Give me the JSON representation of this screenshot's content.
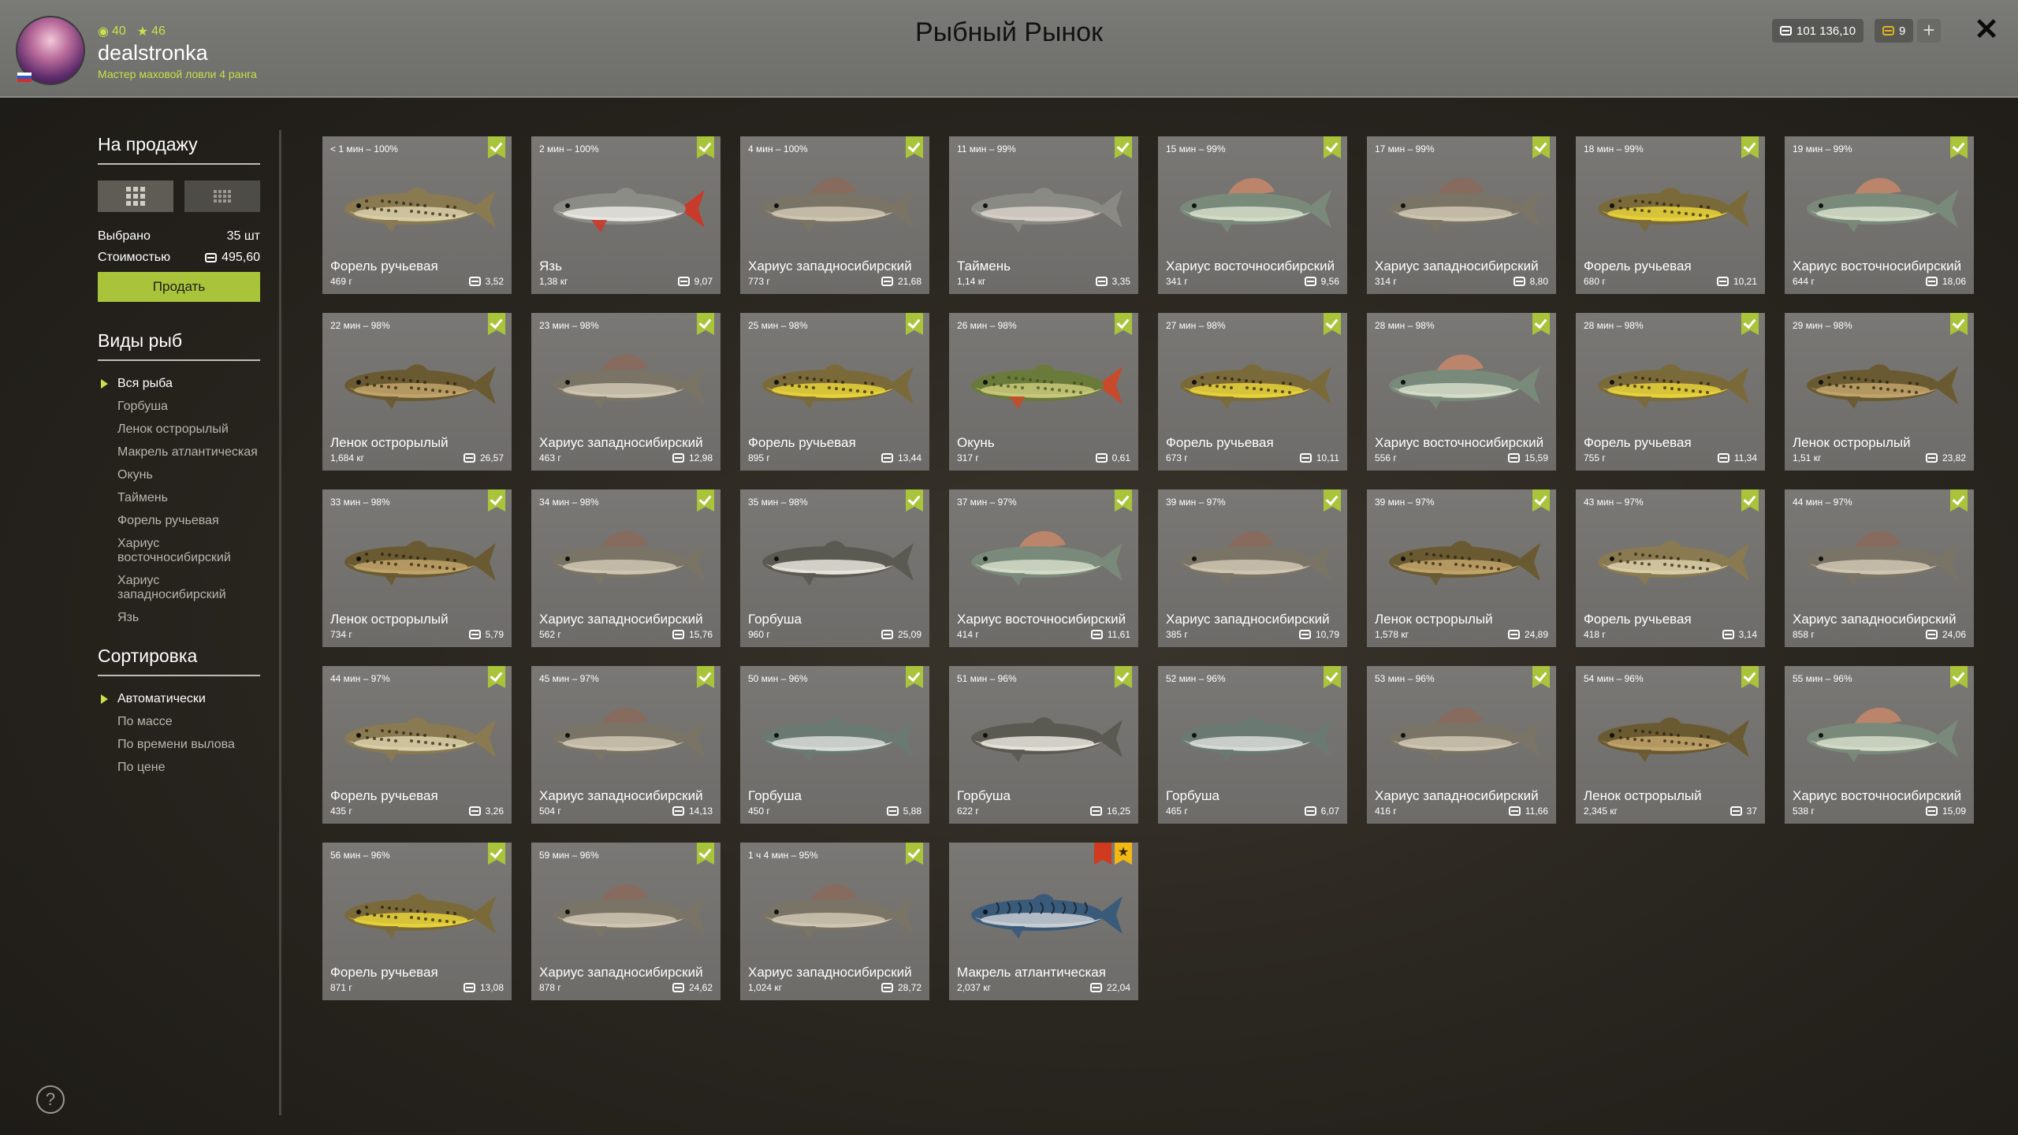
{
  "header": {
    "stat_points": "40",
    "stat_stars": "46",
    "username": "dealstronka",
    "rank": "Мастер маховой ловли 4 ранга",
    "title": "Рыбный Рынок",
    "silver": "101 136,10",
    "gold": "9"
  },
  "sidebar": {
    "sale_title": "На продажу",
    "selected_label": "Выбрано",
    "selected_value": "35 шт",
    "cost_label": "Стоимостью",
    "cost_value": "495,60",
    "sell_button": "Продать",
    "species_title": "Виды рыб",
    "species": [
      "Вся рыба",
      "Горбуша",
      "Ленок острорылый",
      "Макрель атлантическая",
      "Окунь",
      "Таймень",
      "Форель ручьевая",
      "Хариус восточносибирский",
      "Хариус западносибирский",
      "Язь"
    ],
    "sort_title": "Сортировка",
    "sort": [
      "Автоматически",
      "По массе",
      "По времени вылова",
      "По цене"
    ]
  },
  "cards": [
    {
      "time": "< 1 мин – 100%",
      "name": "Форель ручьевая",
      "weight": "469 г",
      "price": "3,52",
      "kind": "brook"
    },
    {
      "time": "2 мин – 100%",
      "name": "Язь",
      "weight": "1,38 кг",
      "price": "9,07",
      "kind": "ide"
    },
    {
      "time": "4 мин – 100%",
      "name": "Хариус западносибирский",
      "weight": "773 г",
      "price": "21,68",
      "kind": "grayW"
    },
    {
      "time": "11 мин – 99%",
      "name": "Таймень",
      "weight": "1,14 кг",
      "price": "3,35",
      "kind": "taimen"
    },
    {
      "time": "15 мин – 99%",
      "name": "Хариус восточносибирский",
      "weight": "341 г",
      "price": "9,56",
      "kind": "grayE"
    },
    {
      "time": "17 мин – 99%",
      "name": "Хариус западносибирский",
      "weight": "314 г",
      "price": "8,80",
      "kind": "grayW"
    },
    {
      "time": "18 мин – 99%",
      "name": "Форель ручьевая",
      "weight": "680 г",
      "price": "10,21",
      "kind": "brookY"
    },
    {
      "time": "19 мин – 99%",
      "name": "Хариус восточносибирский",
      "weight": "644 г",
      "price": "18,06",
      "kind": "grayE"
    },
    {
      "time": "22 мин – 98%",
      "name": "Ленок острорылый",
      "weight": "1,684 кг",
      "price": "26,57",
      "kind": "lenok"
    },
    {
      "time": "23 мин – 98%",
      "name": "Хариус западносибирский",
      "weight": "463 г",
      "price": "12,98",
      "kind": "grayW"
    },
    {
      "time": "25 мин – 98%",
      "name": "Форель ручьевая",
      "weight": "895 г",
      "price": "13,44",
      "kind": "brookY"
    },
    {
      "time": "26 мин – 98%",
      "name": "Окунь",
      "weight": "317 г",
      "price": "0,61",
      "kind": "perch"
    },
    {
      "time": "27 мин – 98%",
      "name": "Форель ручьевая",
      "weight": "673 г",
      "price": "10,11",
      "kind": "brookY"
    },
    {
      "time": "28 мин – 98%",
      "name": "Хариус восточносибирский",
      "weight": "556 г",
      "price": "15,59",
      "kind": "grayE"
    },
    {
      "time": "28 мин – 98%",
      "name": "Форель ручьевая",
      "weight": "755 г",
      "price": "11,34",
      "kind": "brookY"
    },
    {
      "time": "29 мин – 98%",
      "name": "Ленок острорылый",
      "weight": "1,51 кг",
      "price": "23,82",
      "kind": "lenok"
    },
    {
      "time": "33 мин – 98%",
      "name": "Ленок острорылый",
      "weight": "734 г",
      "price": "5,79",
      "kind": "lenok"
    },
    {
      "time": "34 мин – 98%",
      "name": "Хариус западносибирский",
      "weight": "562 г",
      "price": "15,76",
      "kind": "grayW"
    },
    {
      "time": "35 мин – 98%",
      "name": "Горбуша",
      "weight": "960 г",
      "price": "25,09",
      "kind": "pink"
    },
    {
      "time": "37 мин – 97%",
      "name": "Хариус восточносибирский",
      "weight": "414 г",
      "price": "11,61",
      "kind": "grayE"
    },
    {
      "time": "39 мин – 97%",
      "name": "Хариус западносибирский",
      "weight": "385 г",
      "price": "10,79",
      "kind": "grayW"
    },
    {
      "time": "39 мин – 97%",
      "name": "Ленок острорылый",
      "weight": "1,578 кг",
      "price": "24,89",
      "kind": "lenok"
    },
    {
      "time": "43 мин – 97%",
      "name": "Форель ручьевая",
      "weight": "418 г",
      "price": "3,14",
      "kind": "brook"
    },
    {
      "time": "44 мин – 97%",
      "name": "Хариус западносибирский",
      "weight": "858 г",
      "price": "24,06",
      "kind": "grayW"
    },
    {
      "time": "44 мин – 97%",
      "name": "Форель ручьевая",
      "weight": "435 г",
      "price": "3,26",
      "kind": "brook"
    },
    {
      "time": "45 мин – 97%",
      "name": "Хариус западносибирский",
      "weight": "504 г",
      "price": "14,13",
      "kind": "grayW"
    },
    {
      "time": "50 мин – 96%",
      "name": "Горбуша",
      "weight": "450 г",
      "price": "5,88",
      "kind": "pinkS"
    },
    {
      "time": "51 мин – 96%",
      "name": "Горбуша",
      "weight": "622 г",
      "price": "16,25",
      "kind": "pink"
    },
    {
      "time": "52 мин – 96%",
      "name": "Горбуша",
      "weight": "465 г",
      "price": "6,07",
      "kind": "pinkS"
    },
    {
      "time": "53 мин – 96%",
      "name": "Хариус западносибирский",
      "weight": "416 г",
      "price": "11,66",
      "kind": "grayW"
    },
    {
      "time": "54 мин – 96%",
      "name": "Ленок острорылый",
      "weight": "2,345 кг",
      "price": "37",
      "kind": "lenok"
    },
    {
      "time": "55 мин – 96%",
      "name": "Хариус восточносибирский",
      "weight": "538 г",
      "price": "15,09",
      "kind": "grayE"
    },
    {
      "time": "56 мин – 96%",
      "name": "Форель ручьевая",
      "weight": "871 г",
      "price": "13,08",
      "kind": "brookY"
    },
    {
      "time": "59 мин – 96%",
      "name": "Хариус западносибирский",
      "weight": "878 г",
      "price": "24,62",
      "kind": "grayW"
    },
    {
      "time": "1 ч 4 мин – 95%",
      "name": "Хариус западносибирский",
      "weight": "1,024 кг",
      "price": "28,72",
      "kind": "grayW"
    },
    {
      "time": "",
      "name": "Макрель атлантическая",
      "weight": "2,037 кг",
      "price": "22,04",
      "kind": "mackerel",
      "trophy": true
    }
  ],
  "fish_colors": {
    "brook": [
      "#8a7a52",
      "#d8cfa8",
      "#3a2a1a"
    ],
    "brookY": [
      "#7a6a3a",
      "#e6d23a",
      "#2a1a0a"
    ],
    "ide": [
      "#8c8c86",
      "#e8e6e0",
      "#c83a2a"
    ],
    "grayW": [
      "#7a7466",
      "#cfc6b2",
      "#8a6a5a"
    ],
    "grayE": [
      "#7a8a7a",
      "#d4dcc8",
      "#c8886a"
    ],
    "taimen": [
      "#8a8a84",
      "#d8d0c8",
      "#b84a3a"
    ],
    "lenok": [
      "#6a5a32",
      "#c0a46a",
      "#3a2a10"
    ],
    "perch": [
      "#6a7a3a",
      "#c8c87a",
      "#c84a2a"
    ],
    "pink": [
      "#5a5a52",
      "#e8e4dc",
      "#b06a50"
    ],
    "pinkS": [
      "#6a7a72",
      "#d8dcd8",
      "#4a5a52"
    ],
    "mackerel": [
      "#3a5a7a",
      "#c8ccd2",
      "#1a2a3a"
    ]
  }
}
